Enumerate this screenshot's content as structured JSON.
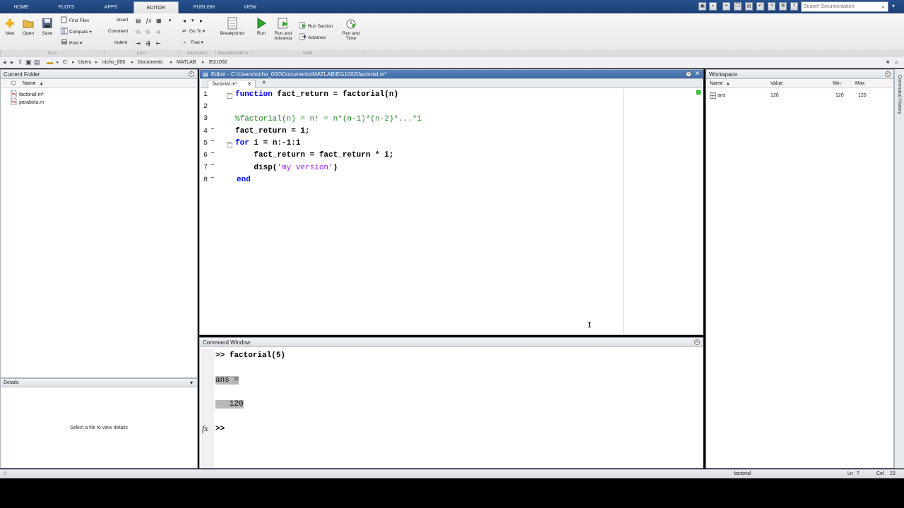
{
  "tabs": [
    "HOME",
    "PLOTS",
    "APPS",
    "EDITOR",
    "PUBLISH",
    "VIEW"
  ],
  "active_tab": "EDITOR",
  "search": {
    "placeholder": "Search Documentation"
  },
  "ribbon": {
    "file": {
      "label": "FILE",
      "new": "New",
      "open": "Open",
      "save": "Save",
      "find_files": "Find Files",
      "compare": "Compare",
      "print": "Print"
    },
    "edit": {
      "label": "EDIT",
      "insert": "Insert",
      "comment": "Comment",
      "indent": "Indent"
    },
    "navigate": {
      "label": "NAVIGATE",
      "go_to": "Go To",
      "find": "Find"
    },
    "breakpoints": {
      "label": "BREAKPOINTS",
      "breakpoints": "Breakpoints"
    },
    "run": {
      "label": "RUN",
      "run": "Run",
      "run_and_advance": "Run and Advance",
      "run_section": "Run Section",
      "advance": "Advance",
      "run_and_time": "Run and Time"
    }
  },
  "path": [
    "C:",
    "Users",
    "nicho_000",
    "Documents",
    "MATLAB",
    "EG1002"
  ],
  "current_folder": {
    "title": "Current Folder",
    "column_name": "Name",
    "files": [
      "factorial.m*",
      "parabola.m"
    ]
  },
  "details": {
    "title": "Details",
    "empty_text": "Select a file to view details"
  },
  "editor": {
    "title": "Editor - C:\\Users\\nicho_000\\Documents\\MATLAB\\EG1002\\factorial.m*",
    "tab_label": "factorial.m*",
    "add_tab": "+",
    "line_numbers": [
      "1",
      "2",
      "3",
      "4",
      "5",
      "6",
      "7",
      "8"
    ],
    "code": {
      "l1_kw": "function",
      "l1_rest": " fact_return = factorial(n)",
      "l3_comment": "%factorial(n) = n! = n*(n-1)*(n-2)*...*1",
      "l4": "fact_return = 1;",
      "l5_kw": "for",
      "l5_rest": " i = n:-1:1",
      "l6": "    fact_return = fact_return * i;",
      "l7_pre": "    disp(",
      "l7_str": "'my version'",
      "l7_post": ")",
      "l8_kw": "end"
    }
  },
  "command_window": {
    "title": "Command Window",
    "lines": [
      ">> factorial(5)",
      "ans =",
      "   120"
    ],
    "fx": "fx",
    "prompt": ">>"
  },
  "workspace": {
    "title": "Workspace",
    "columns": [
      "Name",
      "Value",
      "Min",
      "Max"
    ],
    "rows": [
      {
        "name": "ans",
        "value": "120",
        "min": "120",
        "max": "120"
      }
    ]
  },
  "command_history_label": "Command History",
  "status": {
    "function_name": "factorial",
    "ln_label": "Ln",
    "ln": "7",
    "col_label": "Col",
    "col": "23"
  }
}
